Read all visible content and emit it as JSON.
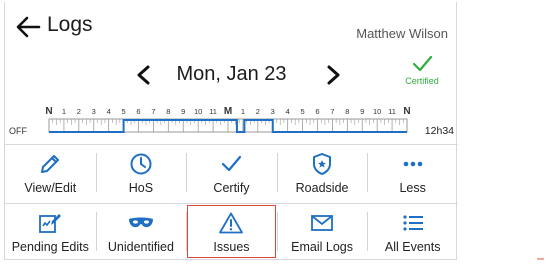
{
  "header": {
    "title": "Logs",
    "driver_name": "Matthew Wilson"
  },
  "date_nav": {
    "date": "Mon, Jan 23",
    "certified_label": "Certified"
  },
  "log_grid": {
    "status_label": "OFF",
    "total": "12h34",
    "hour_labels": [
      "N",
      "1",
      "2",
      "3",
      "4",
      "5",
      "6",
      "7",
      "8",
      "9",
      "10",
      "11",
      "M",
      "1",
      "2",
      "3",
      "4",
      "5",
      "6",
      "7",
      "8",
      "9",
      "10",
      "11",
      "N"
    ]
  },
  "actions_row1": [
    {
      "label": "View/Edit",
      "icon": "pencil-icon"
    },
    {
      "label": "HoS",
      "icon": "clock-icon"
    },
    {
      "label": "Certify",
      "icon": "checkmark-icon"
    },
    {
      "label": "Roadside",
      "icon": "badge-icon"
    },
    {
      "label": "Less",
      "icon": "more-dots-icon"
    }
  ],
  "actions_row2": [
    {
      "label": "Pending Edits",
      "icon": "pending-edits-icon"
    },
    {
      "label": "Unidentified",
      "icon": "mask-icon"
    },
    {
      "label": "Issues",
      "icon": "warning-icon",
      "selected": true
    },
    {
      "label": "Email Logs",
      "icon": "envelope-icon"
    },
    {
      "label": "All Events",
      "icon": "list-icon"
    }
  ],
  "colors": {
    "accent_blue": "#1f6fc5",
    "certified_green": "#2eae3e",
    "selected_outline": "#d9463b"
  }
}
